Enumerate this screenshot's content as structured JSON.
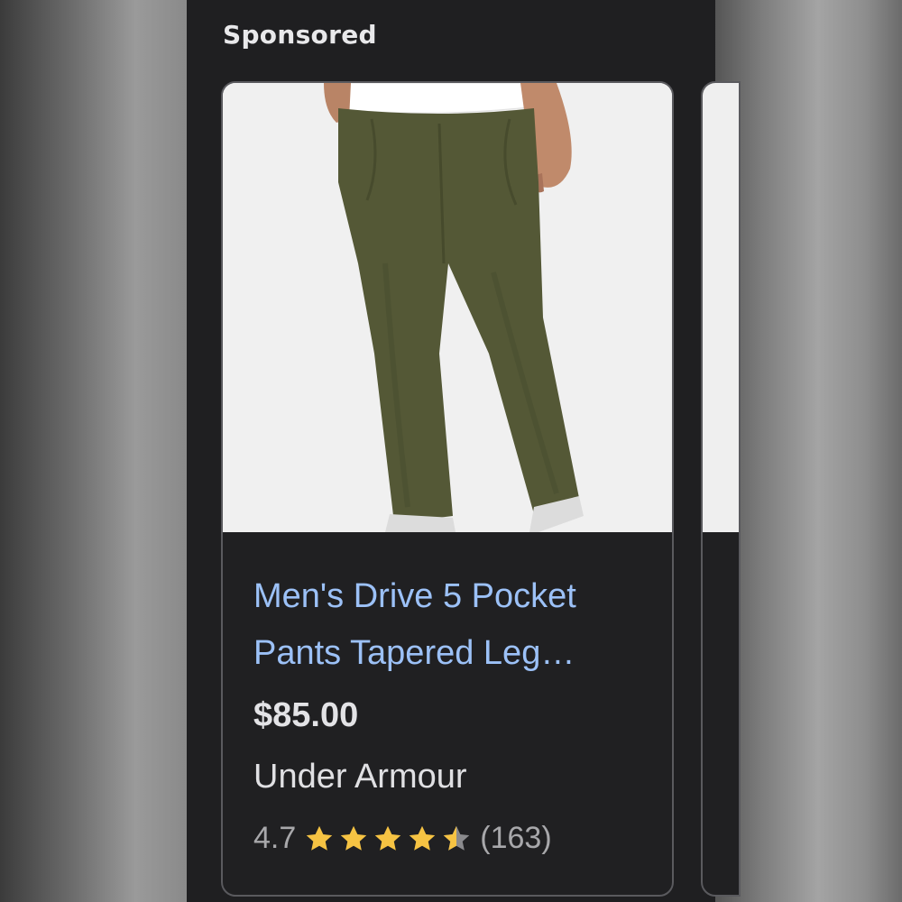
{
  "header": {
    "section_label": "Sponsored"
  },
  "product": {
    "title": "Men's Drive 5 Pocket Pants Tapered Leg…",
    "price": "$85.00",
    "brand": "Under Armour",
    "rating": "4.7",
    "rating_value": 4.7,
    "rating_max": 5,
    "review_count": "(163)",
    "image_icon": "olive-pants-photo"
  },
  "colors": {
    "title_link": "#9cc1f7",
    "star": "#f6c343",
    "panel_bg": "#1f1f21",
    "pants": "#545836"
  }
}
